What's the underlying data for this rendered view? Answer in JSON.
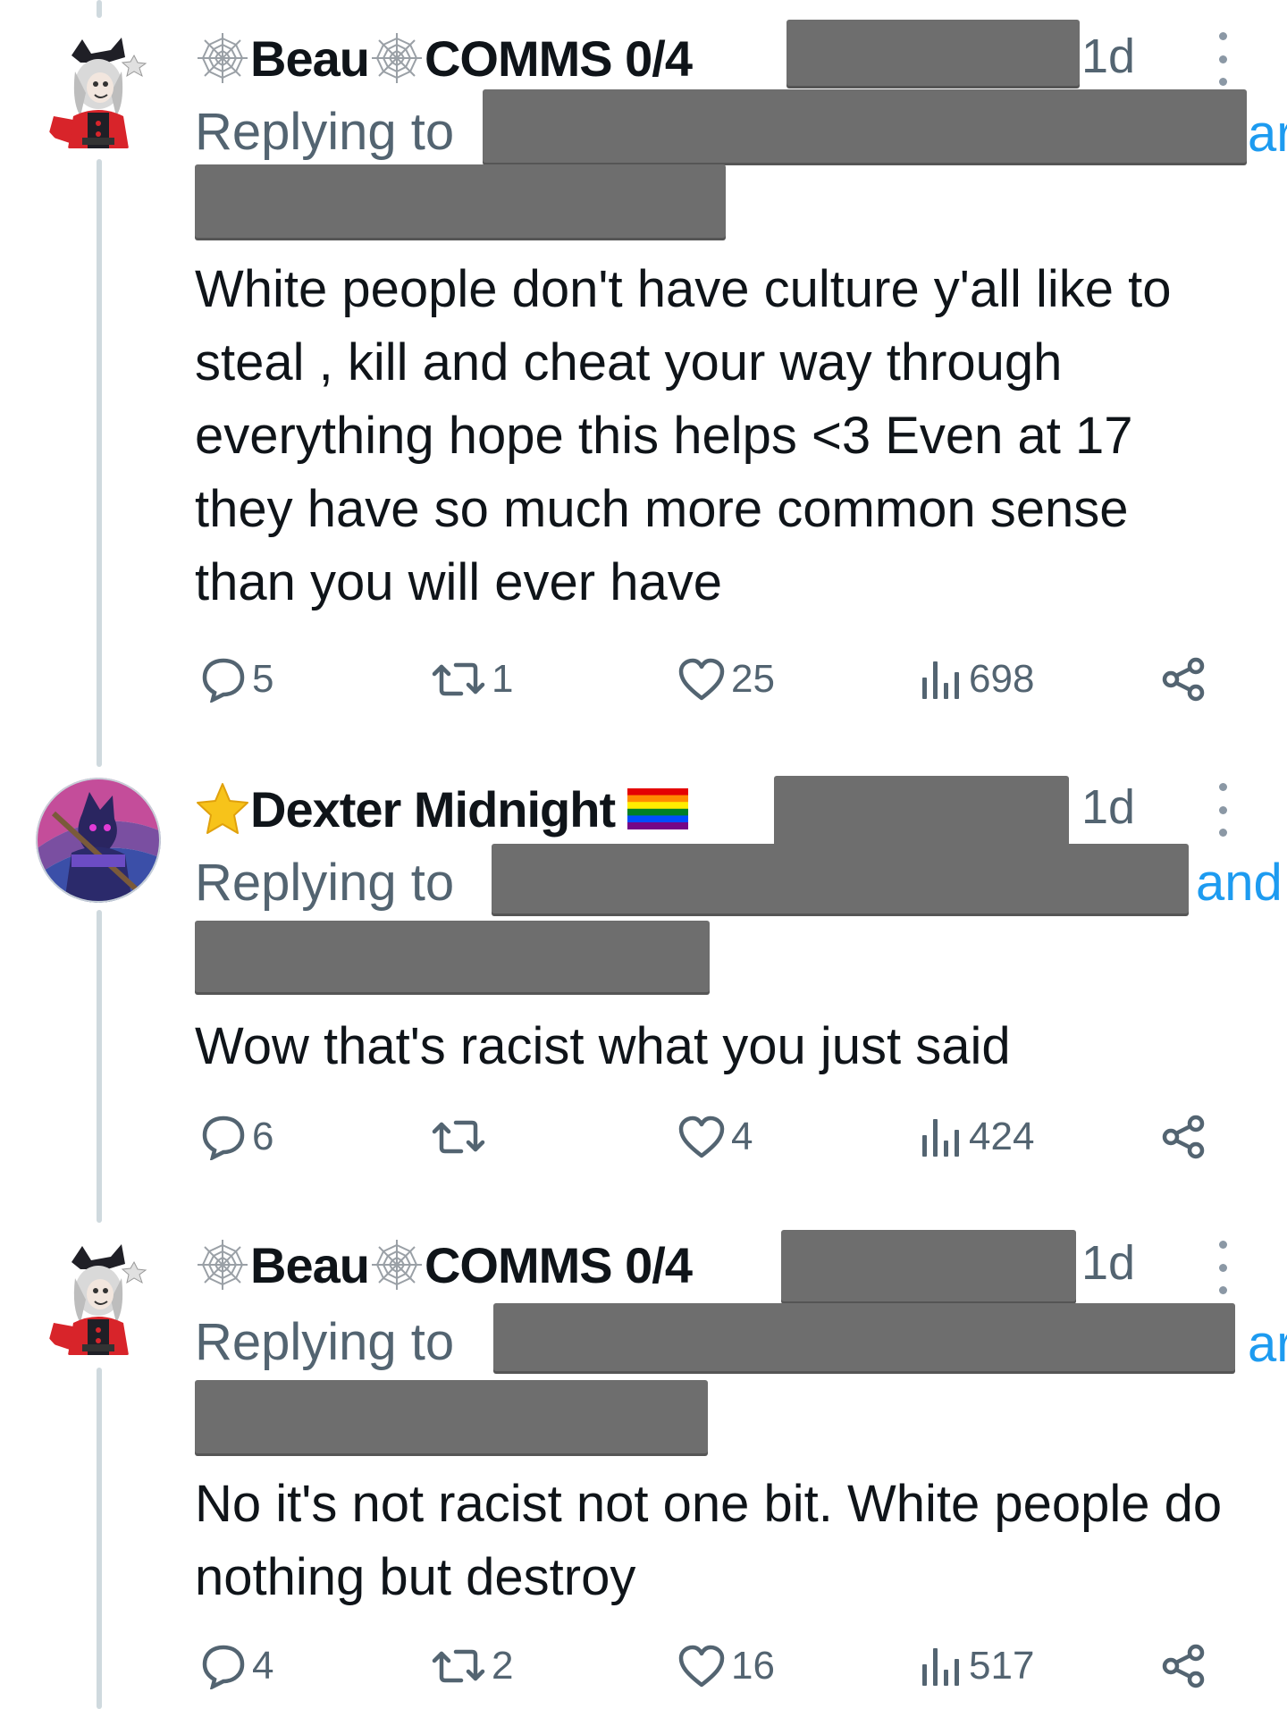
{
  "tweets": [
    {
      "display_name": "Beau",
      "name_suffix": "COMMS 0/4",
      "time": "1d",
      "replying_label": "Replying to",
      "overflow_text": "ar",
      "body": "White people don't have culture y'all like to steal , kill and cheat your way through everything hope this helps <3 Even at 17 they have so much more common sense than you will ever have",
      "replies": "5",
      "reposts": "1",
      "likes": "25",
      "views": "698"
    },
    {
      "display_name": "Dexter Midnight",
      "name_suffix": "",
      "time": "1d",
      "replying_label": "Replying to",
      "overflow_text": "and",
      "body": "Wow that's racist what you just said",
      "replies": "6",
      "reposts": "",
      "likes": "4",
      "views": "424"
    },
    {
      "display_name": "Beau",
      "name_suffix": "COMMS 0/4",
      "time": "1d",
      "replying_label": "Replying to",
      "overflow_text": "ar",
      "body": "No it's not racist not one bit. White people do nothing but destroy",
      "replies": "4",
      "reposts": "2",
      "likes": "16",
      "views": "517"
    }
  ],
  "icons": {
    "reply": "reply-bubble-icon",
    "repost": "repost-icon",
    "like": "heart-icon",
    "views": "views-bars-icon",
    "share": "share-icon",
    "more": "more-vertical-icon",
    "web": "spiderweb-emoji-icon",
    "star": "star-emoji-icon",
    "flag": "rainbow-flag-emoji-icon"
  },
  "colors": {
    "text": "#0f1419",
    "muted": "#536471",
    "link": "#1d9bf0",
    "redaction": "#6e6e6e",
    "thread_line": "#cfd9de"
  }
}
